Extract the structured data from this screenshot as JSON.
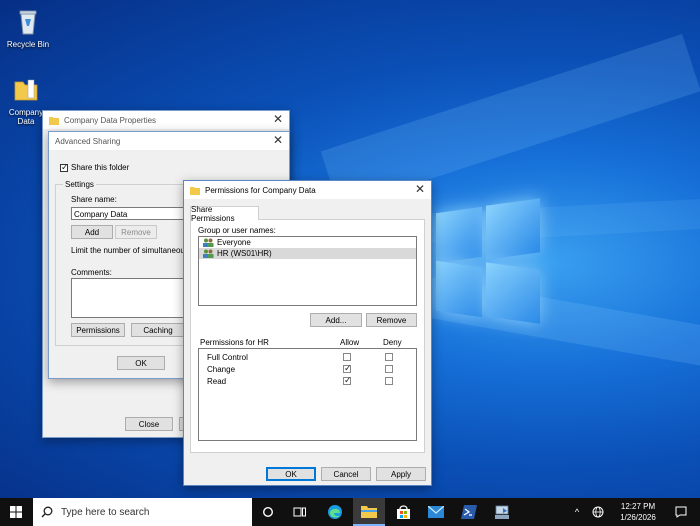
{
  "desktop": {
    "icons": [
      {
        "label": "Recycle Bin",
        "icon": "recycle-bin-icon"
      },
      {
        "label": "Company Data",
        "label_line1": "Company",
        "label_line2": "Data",
        "icon": "folder-icon"
      }
    ]
  },
  "properties_window": {
    "title": "Company Data Properties",
    "close_label": "Close"
  },
  "advanced_sharing": {
    "title": "Advanced Sharing",
    "share_checkbox_label": "Share this folder",
    "share_checked": true,
    "settings_label": "Settings",
    "share_name_label": "Share name:",
    "share_name_value": "Company Data",
    "add_label": "Add",
    "remove_label": "Remove",
    "limit_label": "Limit the number of simultaneous u",
    "comments_label": "Comments:",
    "permissions_label": "Permissions",
    "caching_label": "Caching",
    "ok_label": "OK"
  },
  "permissions_dialog": {
    "title": "Permissions for Company Data",
    "tab_label": "Share Permissions",
    "group_label": "Group or user names:",
    "users": [
      {
        "name": "Everyone",
        "icon": "users-icon",
        "selected": false
      },
      {
        "name": "HR (WS01\\HR)",
        "icon": "users-icon",
        "selected": true
      }
    ],
    "add_label": "Add...",
    "remove_label": "Remove",
    "permissions_for_label": "Permissions for HR",
    "allow_label": "Allow",
    "deny_label": "Deny",
    "permissions": [
      {
        "name": "Full Control",
        "allow": false,
        "deny": false
      },
      {
        "name": "Change",
        "allow": true,
        "deny": false
      },
      {
        "name": "Read",
        "allow": true,
        "deny": false
      }
    ],
    "ok_label": "OK",
    "cancel_label": "Cancel",
    "apply_label": "Apply"
  },
  "taskbar": {
    "search_placeholder": "Type here to search",
    "time": "12:27 PM",
    "date": "1/26/2026",
    "pinned": [
      "task-view-icon",
      "edge-icon",
      "file-explorer-icon",
      "store-icon",
      "mail-icon",
      "powershell-icon",
      "server-manager-icon"
    ]
  }
}
